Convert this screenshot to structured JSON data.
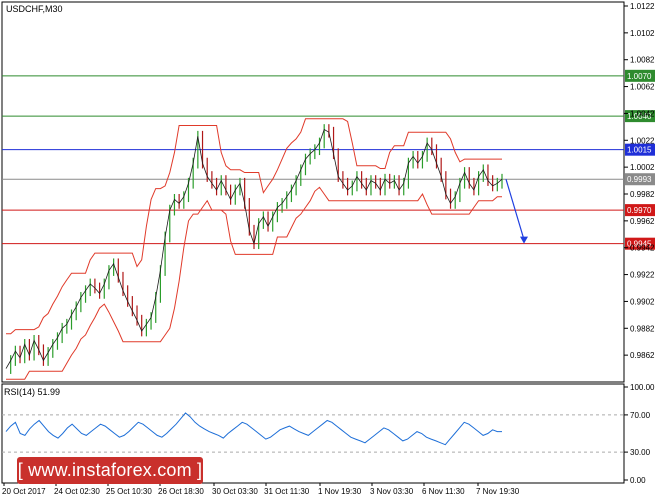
{
  "chart_data": [
    {
      "type": "line",
      "title": "USDCHF,M30",
      "ylim": [
        0.9842,
        1.0122
      ],
      "yticks": [
        "1.0122",
        "1.0102",
        "1.0082",
        "1.0062",
        "1.0042",
        "1.0022",
        "1.0002",
        "0.9982",
        "0.9962",
        "0.9942",
        "0.9922",
        "0.9902",
        "0.9882",
        "0.9862"
      ],
      "xtick_labels": [
        "20 Oct 2017",
        "24 Oct 02:30",
        "25 Oct 10:30",
        "26 Oct 18:30",
        "30 Oct 03:30",
        "31 Oct 11:30",
        "1 Nov 19:30",
        "3 Nov 03:30",
        "6 Nov 11:30",
        "7 Nov 19:30"
      ],
      "levels": [
        {
          "value": 1.007,
          "label": "1.0070",
          "color": "#2e8b2e"
        },
        {
          "value": 1.004,
          "label": "1.0040",
          "color": "#2e8b2e"
        },
        {
          "value": 1.0015,
          "label": "1.0015",
          "color": "#1f2fd8"
        },
        {
          "value": 0.9993,
          "label": "0.9993",
          "color": "#8a8a8a"
        },
        {
          "value": 0.997,
          "label": "0.9970",
          "color": "#d01818"
        },
        {
          "value": 0.9945,
          "label": "0.9945",
          "color": "#d01818"
        }
      ],
      "series": [
        {
          "values": [
            0.9852,
            0.9858,
            0.9865,
            0.986,
            0.987,
            0.9862,
            0.9873,
            0.9866,
            0.9858,
            0.9864,
            0.987,
            0.9875,
            0.9882,
            0.9885,
            0.9892,
            0.9898,
            0.9905,
            0.991,
            0.9915,
            0.9912,
            0.9908,
            0.9915,
            0.9925,
            0.993,
            0.992,
            0.991,
            0.9902,
            0.9895,
            0.9888,
            0.988,
            0.9885,
            0.989,
            0.9905,
            0.9925,
            0.995,
            0.997,
            0.9978,
            0.9975,
            0.998,
            0.999,
            1.0005,
            1.0025,
            1.0005,
            0.9995,
            0.999,
            0.9985,
            0.9992,
            0.9985,
            0.9978,
            0.9985,
            0.999,
            0.9975,
            0.9955,
            0.9945,
            0.996,
            0.9965,
            0.9958,
            0.9965,
            0.9972,
            0.9975,
            0.998,
            0.9985,
            0.9992,
            1.0,
            1.0008,
            1.0012,
            1.0015,
            1.002,
            1.003,
            1.0028,
            1.0012,
            0.9995,
            0.999,
            0.9985,
            0.9988,
            0.9995,
            0.999,
            0.9985,
            0.9992,
            0.999,
            0.9985,
            0.9993,
            0.999,
            0.9992,
            0.9985,
            0.999,
            1.0005,
            1.001,
            1.0005,
            1.001,
            1.002,
            1.0015,
            1.0005,
            0.9995,
            0.9982,
            0.9975,
            0.998,
            0.999,
            0.9998,
            0.999,
            0.9985,
            0.9995,
            1.0,
            0.9992,
            0.9988,
            0.999,
            0.9993
          ]
        }
      ],
      "forecast_arrow": {
        "from": 0.9993,
        "to": 0.9945
      }
    },
    {
      "type": "line",
      "title": "RSI(14) 51.99",
      "ylim": [
        0,
        100
      ],
      "yticks": [
        "100.00",
        "70.00",
        "30.00",
        "0.00"
      ],
      "levels": [
        70,
        30
      ],
      "series": [
        {
          "values": [
            52,
            58,
            62,
            50,
            48,
            55,
            60,
            64,
            58,
            52,
            48,
            45,
            50,
            56,
            60,
            55,
            50,
            48,
            52,
            56,
            60,
            58,
            54,
            50,
            46,
            48,
            52,
            57,
            62,
            60,
            56,
            52,
            48,
            46,
            50,
            55,
            60,
            66,
            72,
            68,
            62,
            58,
            55,
            52,
            50,
            48,
            45,
            50,
            54,
            58,
            62,
            60,
            56,
            52,
            48,
            44,
            46,
            50,
            54,
            56,
            58,
            55,
            52,
            50,
            48,
            52,
            56,
            60,
            64,
            62,
            58,
            54,
            50,
            46,
            44,
            42,
            40,
            44,
            48,
            52,
            56,
            54,
            50,
            46,
            42,
            44,
            48,
            52,
            50,
            46,
            44,
            42,
            40,
            38,
            44,
            50,
            56,
            62,
            60,
            56,
            52,
            48,
            50,
            54,
            52,
            52
          ]
        }
      ]
    }
  ],
  "watermark": "[ www.instaforex.com ]"
}
